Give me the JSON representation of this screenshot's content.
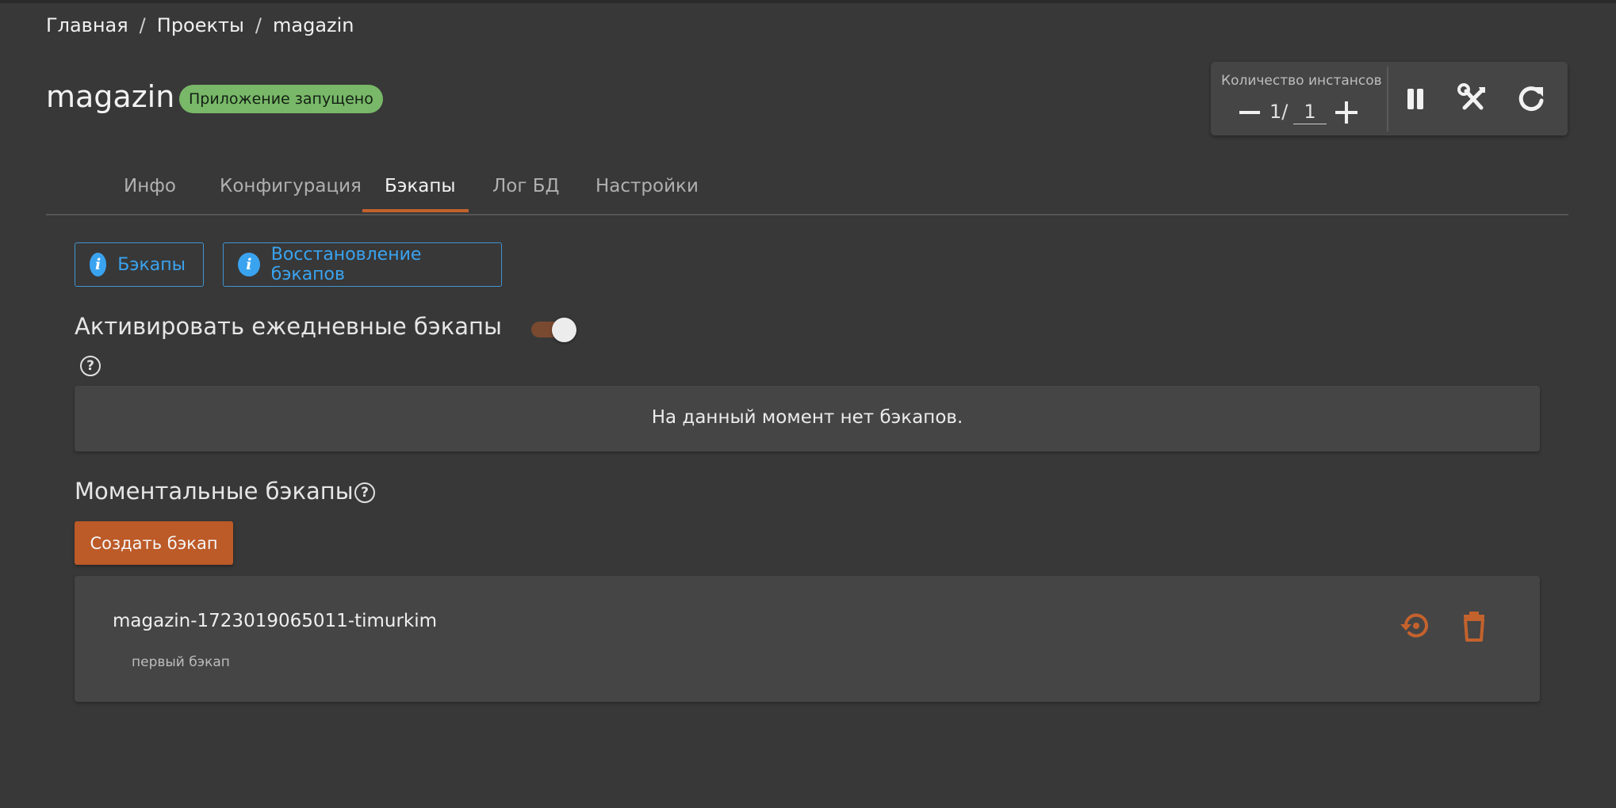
{
  "breadcrumb": {
    "items": [
      "Главная",
      "Проекты",
      "magazin"
    ],
    "separator": "/"
  },
  "app": {
    "name": "magazin",
    "status": "Приложение запущено"
  },
  "instances": {
    "label": "Количество инстансов",
    "current": "1/",
    "target": "1"
  },
  "controls": {
    "pause": "pause-icon",
    "maintenance": "tools-icon",
    "restart": "refresh-icon"
  },
  "tabs": [
    {
      "label": "Инфо",
      "active": false
    },
    {
      "label": "Конфигурация",
      "active": false
    },
    {
      "label": "Бэкапы",
      "active": true
    },
    {
      "label": "Лог БД",
      "active": false
    },
    {
      "label": "Настройки",
      "active": false
    }
  ],
  "info_buttons": [
    "Бэкапы",
    "Восстановление бэкапов"
  ],
  "daily": {
    "title": "Активировать ежедневные бэкапы",
    "enabled": true,
    "empty_text": "На данный момент нет бэкапов."
  },
  "instant": {
    "title": "Моментальные бэкапы",
    "create_label": "Создать бэкап"
  },
  "backups": [
    {
      "name": "magazin-1723019065011-timurkim",
      "description": "первый бэкап"
    }
  ],
  "colors": {
    "accent": "#c4622d",
    "success": "#78b868",
    "info": "#3aa3f0",
    "background": "#383838",
    "panel": "#454545"
  }
}
